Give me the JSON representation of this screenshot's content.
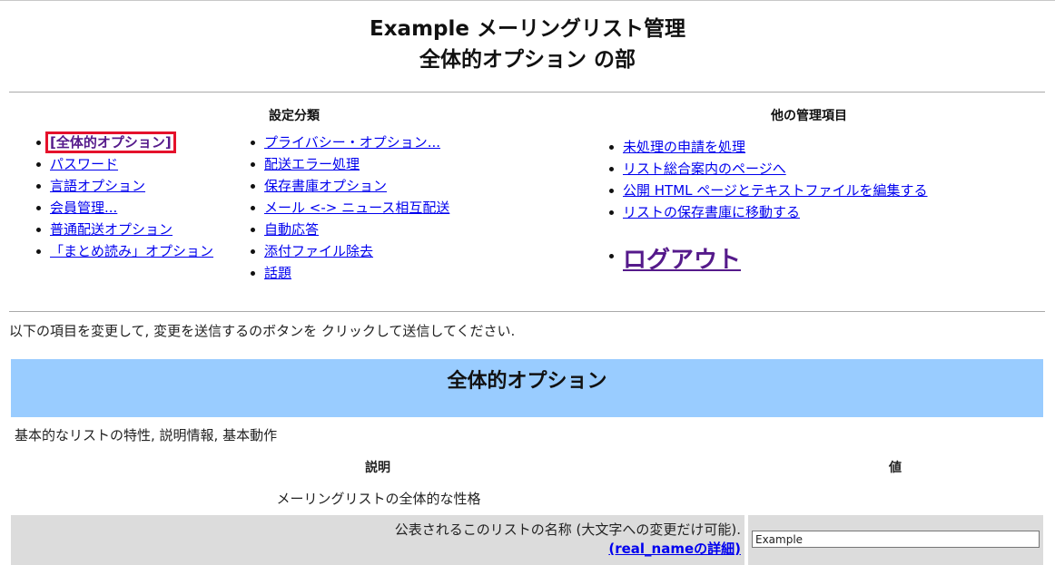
{
  "header": {
    "title_line1": "Example メーリングリスト管理",
    "title_line2": "全体的オプション の部"
  },
  "nav": {
    "categories_heading": "設定分類",
    "other_heading": "他の管理項目",
    "col1": [
      {
        "label": "[全体的オプション]"
      },
      {
        "label": "パスワード"
      },
      {
        "label": "言語オプション"
      },
      {
        "label": "会員管理..."
      },
      {
        "label": "普通配送オプション"
      },
      {
        "label": "「まとめ読み」オプション"
      }
    ],
    "col2": [
      {
        "label": "プライバシー・オプション..."
      },
      {
        "label": "配送エラー処理"
      },
      {
        "label": "保存書庫オプション"
      },
      {
        "label": "メール <-> ニュース相互配送"
      },
      {
        "label": "自動応答"
      },
      {
        "label": "添付ファイル除去"
      },
      {
        "label": "話題"
      }
    ],
    "other": [
      {
        "label": "未処理の申請を処理"
      },
      {
        "label": "リスト総合案内のページへ"
      },
      {
        "label": "公開 HTML ページとテキストファイルを編集する"
      },
      {
        "label": "リストの保存書庫に移動する"
      }
    ],
    "logout": "ログアウト"
  },
  "main": {
    "instructions": "以下の項目を変更して, 変更を送信するのボタンを クリックして送信してください.",
    "section_title": "全体的オプション",
    "section_subtitle": "基本的なリストの特性, 説明情報, 基本動作",
    "col_description": "説明",
    "col_value": "値",
    "group_title": "メーリングリストの全体的な性格",
    "real_name": {
      "label": "公表されるこのリストの名称 (大文字への変更だけ可能).",
      "details_link": "(real_nameの詳細)",
      "value": "Example"
    }
  }
}
